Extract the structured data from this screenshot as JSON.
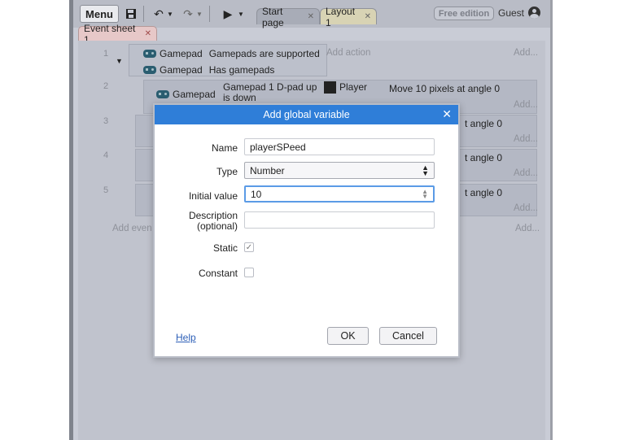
{
  "toolbar": {
    "menu_label": "Menu"
  },
  "tabs": [
    {
      "label": "Start page"
    },
    {
      "label": "Layout 1"
    }
  ],
  "account": {
    "edition": "Free edition",
    "user": "Guest"
  },
  "event_sheet": {
    "tab_label": "Event sheet 1",
    "rows": [
      {
        "num": "1",
        "object": "Gamepad",
        "cond1": "Gamepads are supported",
        "cond2": "Has gamepads",
        "add_action": "Add action",
        "add": "Add..."
      },
      {
        "num": "2",
        "object": "Gamepad",
        "cond": "Gamepad 1 D-pad up",
        "cond_tail": "is down",
        "action_object": "Player",
        "action": "Move 10 pixels at angle 0",
        "add": "Add..."
      },
      {
        "num": "3",
        "action_tail": "t angle 0",
        "add": "Add..."
      },
      {
        "num": "4",
        "action_tail": "t angle 0",
        "add": "Add..."
      },
      {
        "num": "5",
        "action_tail": "t angle 0",
        "add": "Add..."
      }
    ],
    "add_event": "Add even",
    "add_bottom": "Add..."
  },
  "dialog": {
    "title": "Add global variable",
    "name_label": "Name",
    "name_value": "playerSPeed",
    "type_label": "Type",
    "type_value": "Number",
    "initial_label": "Initial value",
    "initial_value": "10",
    "desc_label": "Description",
    "desc_label2": "(optional)",
    "static_label": "Static",
    "constant_label": "Constant",
    "help_label": "Help",
    "ok_label": "OK",
    "cancel_label": "Cancel"
  }
}
